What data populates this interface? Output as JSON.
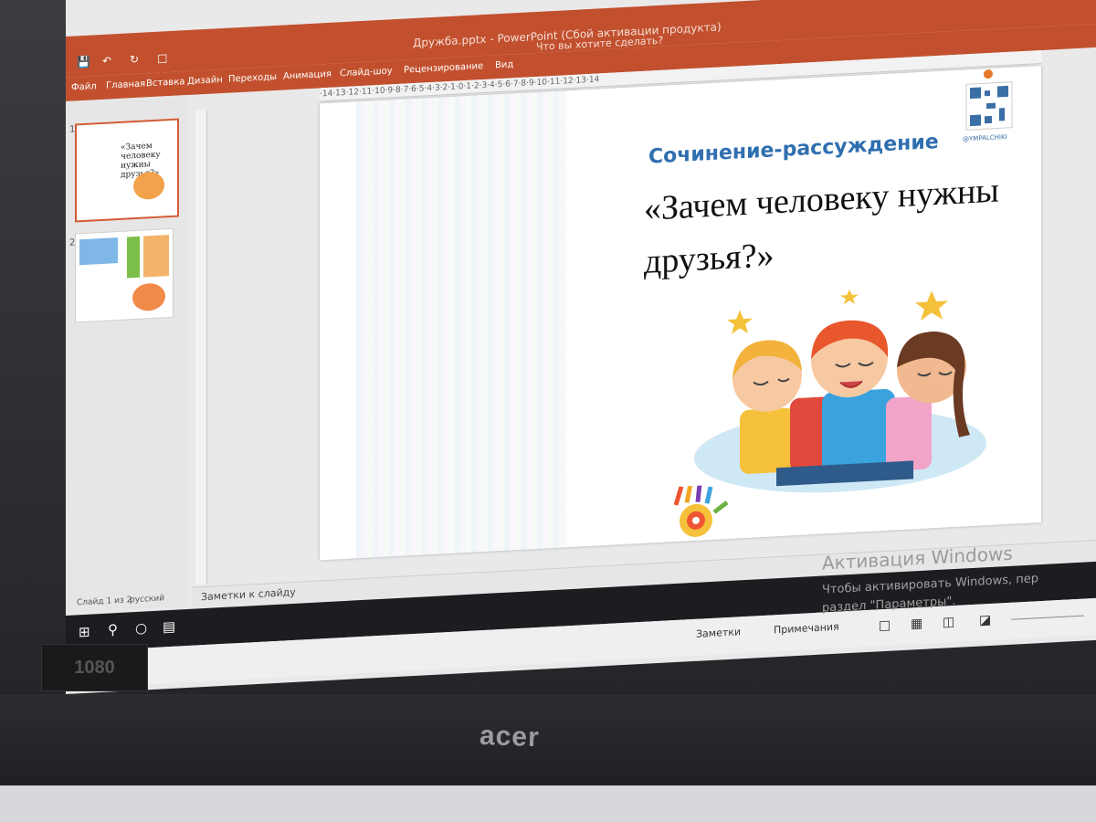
{
  "window": {
    "title": "Дружба.pptx - PowerPoint (Сбой активации продукта)",
    "tell_me": "Что вы хотите сделать?"
  },
  "ribbon": {
    "tabs": [
      "Файл",
      "Главная",
      "Вставка",
      "Дизайн",
      "Переходы",
      "Анимация",
      "Слайд-шоу",
      "Рецензирование",
      "Вид"
    ]
  },
  "ruler": {
    "top_marks": "·14·13·12·11·10·9·8·7·6·5·4·3·2·1·0·1·2·3·4·5·6·7·8·9·10·11·12·13·14"
  },
  "thumbnails": [
    {
      "number": "1",
      "text": "«Зачем человеку нужны друзья?»"
    },
    {
      "number": "2",
      "text": ""
    }
  ],
  "slide": {
    "subtitle": "Сочинение-рассуждение",
    "title": "«Зачем человеку нужны друзья?»",
    "qr_caption": "@YMPALCHIKI"
  },
  "notes": {
    "label": "Заметки к слайду"
  },
  "status": {
    "slide": "Слайд 1 из 2",
    "language": "русский"
  },
  "viewbar": {
    "notes_button": "Заметки",
    "comments_button": "Примечания"
  },
  "activation": {
    "title": "Активация Windows",
    "line1": "Чтобы активировать Windows, пер",
    "line2": "раздел \"Параметры\"."
  },
  "device": {
    "brand": "acer",
    "sticker": "1080"
  }
}
